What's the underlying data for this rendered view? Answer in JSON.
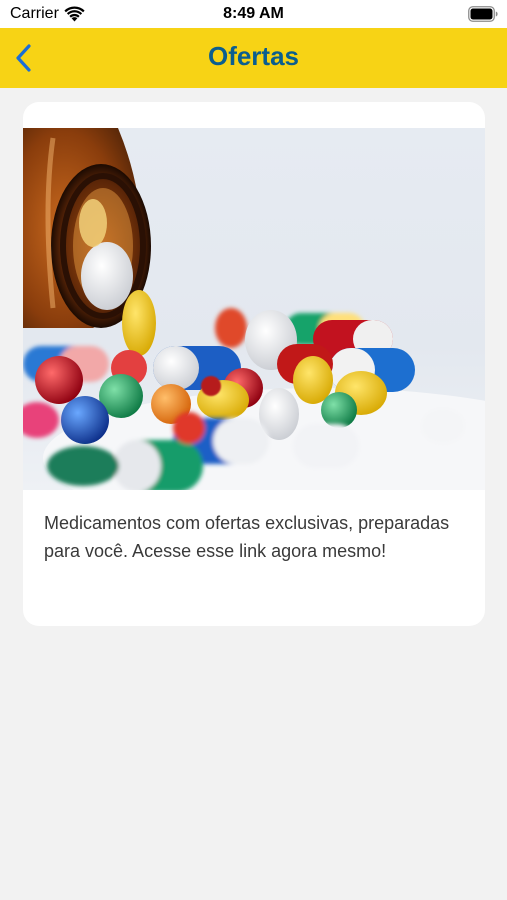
{
  "status_bar": {
    "carrier": "Carrier",
    "time": "8:49 AM"
  },
  "nav": {
    "title": "Ofertas",
    "back_icon": "chevron-left-icon"
  },
  "offer": {
    "image_alt": "Medicamentos",
    "description": "Medicamentos com ofertas exclusivas, preparadas para você. Acesse esse link agora mesmo!"
  },
  "colors": {
    "nav_background": "#f7d315",
    "accent": "#0b5e8f",
    "page_background": "#f2f2f2"
  }
}
